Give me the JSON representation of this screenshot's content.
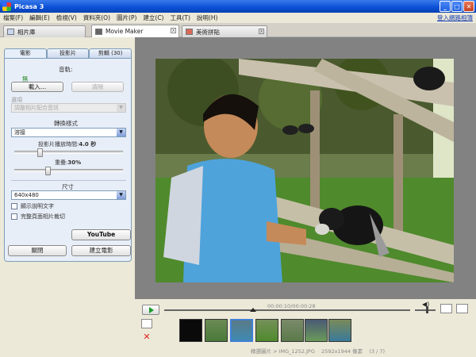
{
  "window": {
    "title": "Picasa 3"
  },
  "menu": [
    "檔案(F)",
    "編輯(E)",
    "檢視(V)",
    "資料夾(O)",
    "圖片(P)",
    "建立(C)",
    "工具(T)",
    "說明(H)"
  ],
  "signin": "登入網路相簿",
  "tabs": [
    {
      "label": "相片庫"
    },
    {
      "label": "Movie Maker",
      "active": true
    },
    {
      "label": "美術拼貼"
    }
  ],
  "subtabs": [
    "電影",
    "投影片",
    "剪輯 (30)"
  ],
  "movie_panel": {
    "audio_track_label": "音軌:",
    "audio_none": "無",
    "load_button": "載入...",
    "clear_button": "清除",
    "options_label": "選項",
    "fit_option": "調整相片配合音訊",
    "transition_label": "轉換樣式",
    "transition_value": "溶接",
    "slide_duration_label": "投影片播放時間:",
    "slide_duration_value": "4.0 秒",
    "slide_duration_fraction": 0.22,
    "overlap_label": "重疊:",
    "overlap_value": "30%",
    "overlap_fraction": 0.3,
    "size_label": "尺寸",
    "size_value": "640x480",
    "show_caption": "顯示說明文字",
    "full_frame_crop": "完整頁面相片裁切"
  },
  "buttons": {
    "youtube": "YouTube",
    "close": "關閉",
    "create": "建立電影"
  },
  "player": {
    "time": "00:00:10/00:00:28",
    "progress_fraction": 0.36,
    "volume_fraction": 0.6,
    "status_path": "精選圖片 > IMG_1252.JPG",
    "status_dims": "2592x1944 像素",
    "status_index": "(3 / 7)"
  },
  "filmstrip_count": 7
}
